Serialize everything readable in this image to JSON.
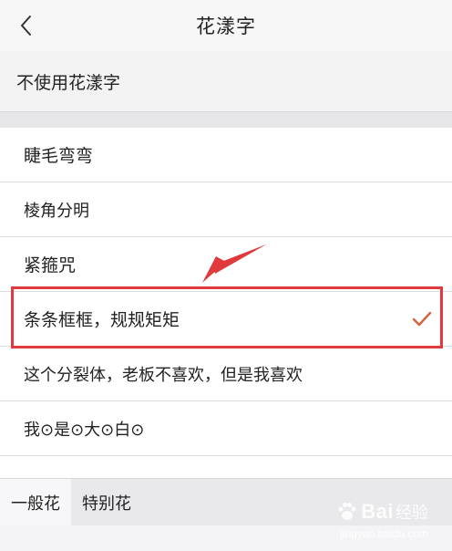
{
  "header": {
    "title": "花漾字",
    "back_icon": "chevron-left-icon"
  },
  "no_font_option": {
    "label": "不使用花漾字"
  },
  "font_styles": [
    {
      "label": "睫毛弯弯"
    },
    {
      "label": "棱角分明"
    },
    {
      "label": "紧箍咒"
    },
    {
      "label": "条条框框，规规矩矩",
      "selected": true
    },
    {
      "label": "这个分裂体，老板不喜欢，但是我喜欢"
    },
    {
      "label": "我⊙是⊙大⊙白⊙"
    }
  ],
  "tabs": [
    {
      "label": "一般花",
      "active": true
    },
    {
      "label": "特别花",
      "active": false
    }
  ],
  "watermark": {
    "brand": "Bai",
    "brand_suffix": "经验",
    "site": "jingyan.baidu.com"
  },
  "colors": {
    "check": "#d8643a",
    "annotation": "#e03a3e",
    "header_bg": "#f7f7f8",
    "tabs_bg": "#e9e9ec"
  }
}
